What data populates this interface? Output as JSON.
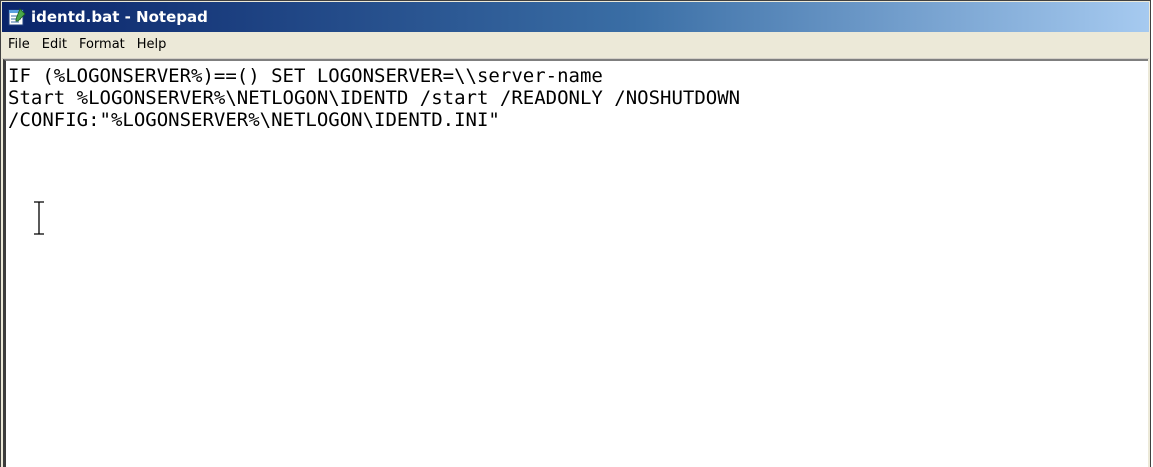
{
  "window": {
    "title": "identd.bat - Notepad",
    "icon": "notepad-icon"
  },
  "menu": {
    "items": [
      "File",
      "Edit",
      "Format",
      "Help"
    ]
  },
  "editor": {
    "lines": [
      "IF (%LOGONSERVER%)==() SET LOGONSERVER=\\\\server-name",
      "Start %LOGONSERVER%\\NETLOGON\\IDENTD /start /READONLY /NOSHUTDOWN",
      "/CONFIG:\"%LOGONSERVER%\\NETLOGON\\IDENTD.INI\""
    ],
    "cursor": "text-ibeam-cursor"
  },
  "colors": {
    "titlebar_start": "#0a246a",
    "titlebar_end": "#a6caf0",
    "menubar_bg": "#ece9d8",
    "editor_bg": "#ffffff"
  }
}
